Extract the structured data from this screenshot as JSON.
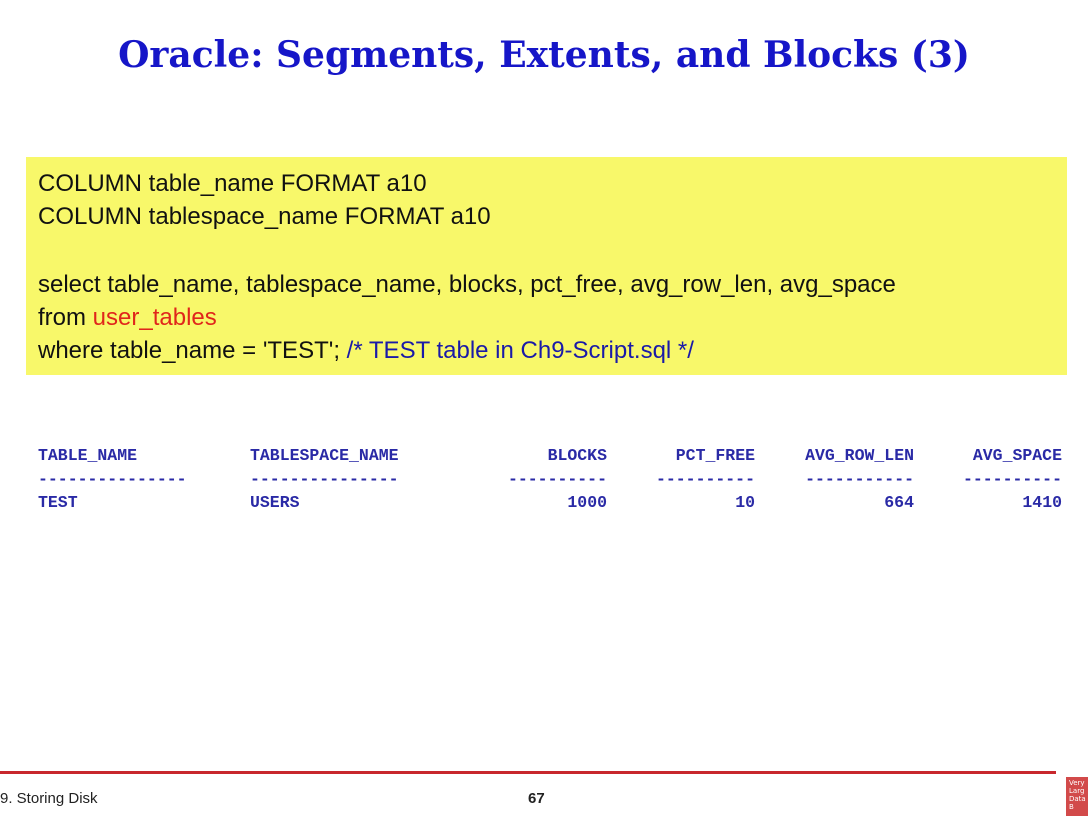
{
  "slide": {
    "title": "Oracle: Segments, Extents, and Blocks (3)"
  },
  "code": {
    "line1": "COLUMN table_name FORMAT a10",
    "line2": "COLUMN tablespace_name FORMAT a10",
    "line3": "select table_name, tablespace_name, blocks, pct_free, avg_row_len, avg_space",
    "line4_prefix": "from ",
    "line4_table": "user_tables",
    "line5_prefix": "where table_name = 'TEST'; ",
    "line5_comment": "/* TEST table in Ch9-Script.sql */"
  },
  "result": {
    "headers": [
      "TABLE_NAME",
      "TABLESPACE_NAME",
      "BLOCKS",
      "PCT_FREE",
      "AVG_ROW_LEN",
      "AVG_SPACE"
    ],
    "separators": [
      "---------------",
      "---------------",
      "----------",
      "----------",
      "-----------",
      "----------"
    ],
    "rows": [
      [
        "TEST",
        "USERS",
        "1000",
        "10",
        "664",
        "1410"
      ]
    ]
  },
  "footer": {
    "chapter": "9. Storing Disk",
    "page": "67",
    "logo_lines": [
      "Very",
      "Larg",
      "Data",
      "B"
    ]
  },
  "colors": {
    "title": "#1616c8",
    "code_bg": "#f8f86a",
    "highlight_red": "#e0261b",
    "comment_blue": "#1a1aa8",
    "result_text": "#2a2aa6",
    "footer_rule": "#c8282d"
  }
}
